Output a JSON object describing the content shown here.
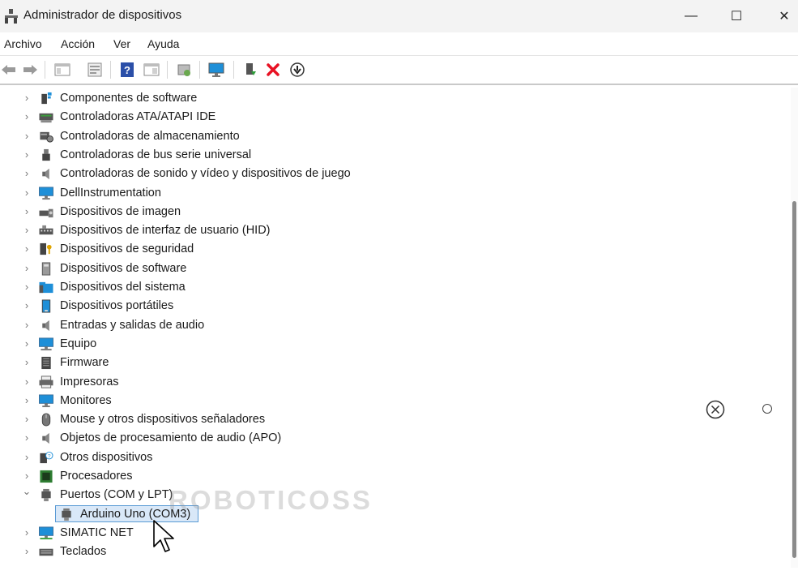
{
  "window": {
    "title": "Administrador de dispositivos",
    "controls": {
      "minimize": "—",
      "maximize": "☐",
      "close": "✕"
    }
  },
  "menu": [
    "Archivo",
    "Acción",
    "Ver",
    "Ayuda"
  ],
  "toolbar": {
    "buttons": [
      "back-icon",
      "forward-icon",
      "console-tree-icon",
      "properties-icon",
      "help-icon",
      "view-icon",
      "scan-hardware-icon",
      "monitor-icon",
      "add-driver-icon",
      "uninstall-icon",
      "disable-icon"
    ]
  },
  "tree": {
    "categories": [
      {
        "label": "Componentes de software",
        "icon": "software-components-icon",
        "expanded": false
      },
      {
        "label": "Controladoras ATA/ATAPI IDE",
        "icon": "ide-controller-icon",
        "expanded": false
      },
      {
        "label": "Controladoras de almacenamiento",
        "icon": "storage-controller-icon",
        "expanded": false
      },
      {
        "label": "Controladoras de bus serie universal",
        "icon": "usb-icon",
        "expanded": false
      },
      {
        "label": "Controladoras de sonido y vídeo y dispositivos de juego",
        "icon": "speaker-icon",
        "expanded": false
      },
      {
        "label": "DellInstrumentation",
        "icon": "monitor-icon",
        "expanded": false
      },
      {
        "label": "Dispositivos de imagen",
        "icon": "camera-icon",
        "expanded": false
      },
      {
        "label": "Dispositivos de interfaz de usuario (HID)",
        "icon": "keyboard-hid-icon",
        "expanded": false
      },
      {
        "label": "Dispositivos de seguridad",
        "icon": "security-key-icon",
        "expanded": false
      },
      {
        "label": "Dispositivos de software",
        "icon": "software-device-icon",
        "expanded": false
      },
      {
        "label": "Dispositivos del sistema",
        "icon": "system-folder-icon",
        "expanded": false
      },
      {
        "label": "Dispositivos portátiles",
        "icon": "portable-device-icon",
        "expanded": false
      },
      {
        "label": "Entradas y salidas de audio",
        "icon": "speaker-icon",
        "expanded": false
      },
      {
        "label": "Equipo",
        "icon": "computer-icon",
        "expanded": false
      },
      {
        "label": "Firmware",
        "icon": "firmware-icon",
        "expanded": false
      },
      {
        "label": "Impresoras",
        "icon": "printer-icon",
        "expanded": false
      },
      {
        "label": "Monitores",
        "icon": "monitor-icon",
        "expanded": false
      },
      {
        "label": "Mouse y otros dispositivos señaladores",
        "icon": "mouse-icon",
        "expanded": false
      },
      {
        "label": "Objetos de procesamiento de audio (APO)",
        "icon": "speaker-icon",
        "expanded": false
      },
      {
        "label": "Otros dispositivos",
        "icon": "unknown-device-icon",
        "expanded": false
      },
      {
        "label": "Procesadores",
        "icon": "processor-icon",
        "expanded": false
      },
      {
        "label": "Puertos (COM y LPT)",
        "icon": "port-icon",
        "expanded": true,
        "children": [
          {
            "label": "Arduino Uno (COM3)",
            "icon": "port-icon",
            "selected": true
          }
        ]
      },
      {
        "label": "SIMATIC NET",
        "icon": "network-icon",
        "expanded": false
      },
      {
        "label": "Teclados",
        "icon": "keyboard-icon",
        "expanded": false
      }
    ]
  },
  "watermark": "ROBOTICOSS",
  "colors": {
    "selection": "#d9e8f8",
    "selection_border": "#5b9bd5",
    "titlebar": "#f3f3f3",
    "accent_red": "#e81123",
    "icon_blue": "#1e8fd8"
  }
}
